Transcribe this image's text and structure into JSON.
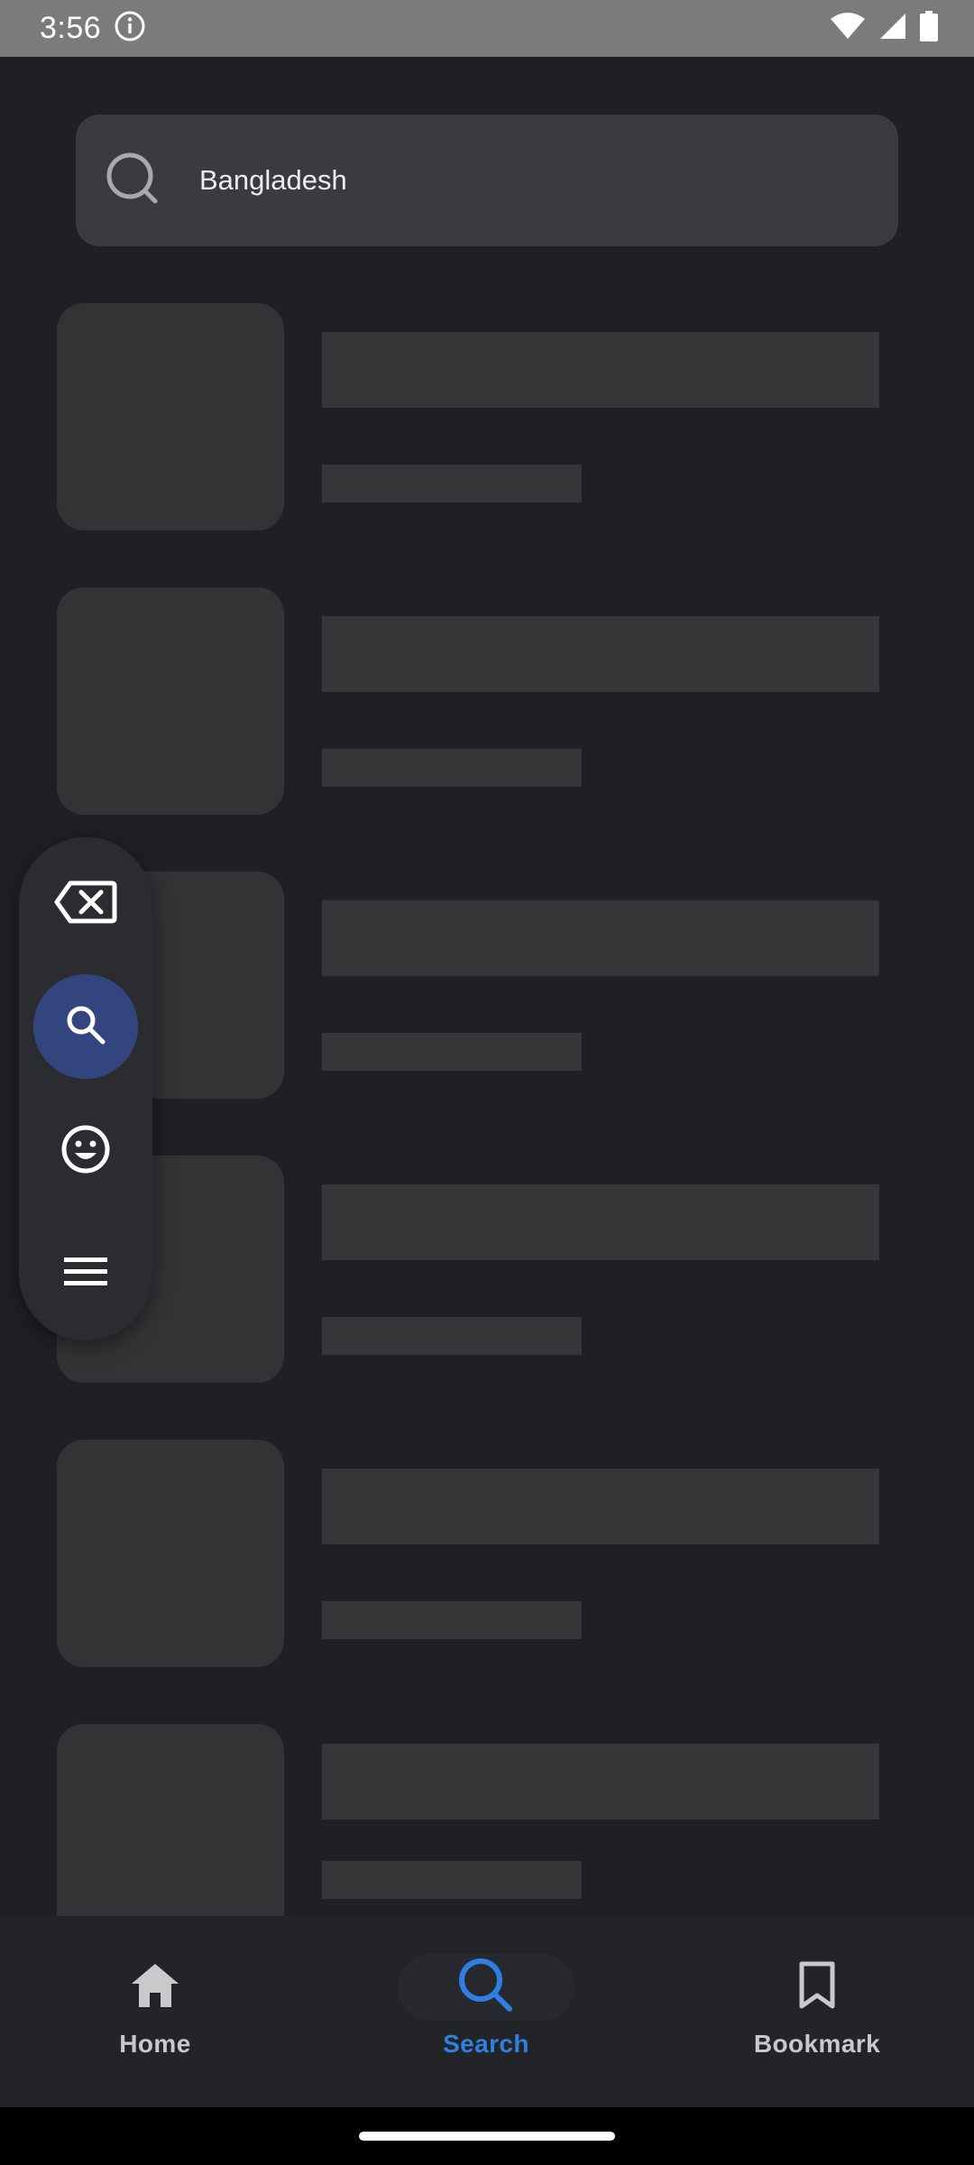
{
  "status_bar": {
    "time": "3:56",
    "icons": [
      "info-icon",
      "wifi-icon",
      "signal-icon",
      "battery-icon"
    ]
  },
  "search": {
    "value": "Bangladesh",
    "icon": "search-icon"
  },
  "results_placeholders": {
    "count": 6,
    "state": "loading"
  },
  "floating_toolbar": {
    "buttons": [
      {
        "icon": "backspace-icon",
        "active": false
      },
      {
        "icon": "search-icon",
        "active": true
      },
      {
        "icon": "emoji-icon",
        "active": false
      },
      {
        "icon": "menu-icon",
        "active": false
      }
    ]
  },
  "bottom_nav": {
    "items": [
      {
        "label": "Home",
        "icon": "home-icon",
        "active": false
      },
      {
        "label": "Search",
        "icon": "search-icon",
        "active": true
      },
      {
        "label": "Bookmark",
        "icon": "bookmark-icon",
        "active": false
      }
    ]
  },
  "colors": {
    "background": "#1f2023",
    "accent": "#2f7fe2",
    "active_pill": "#33457e",
    "skeleton": "#323335"
  }
}
